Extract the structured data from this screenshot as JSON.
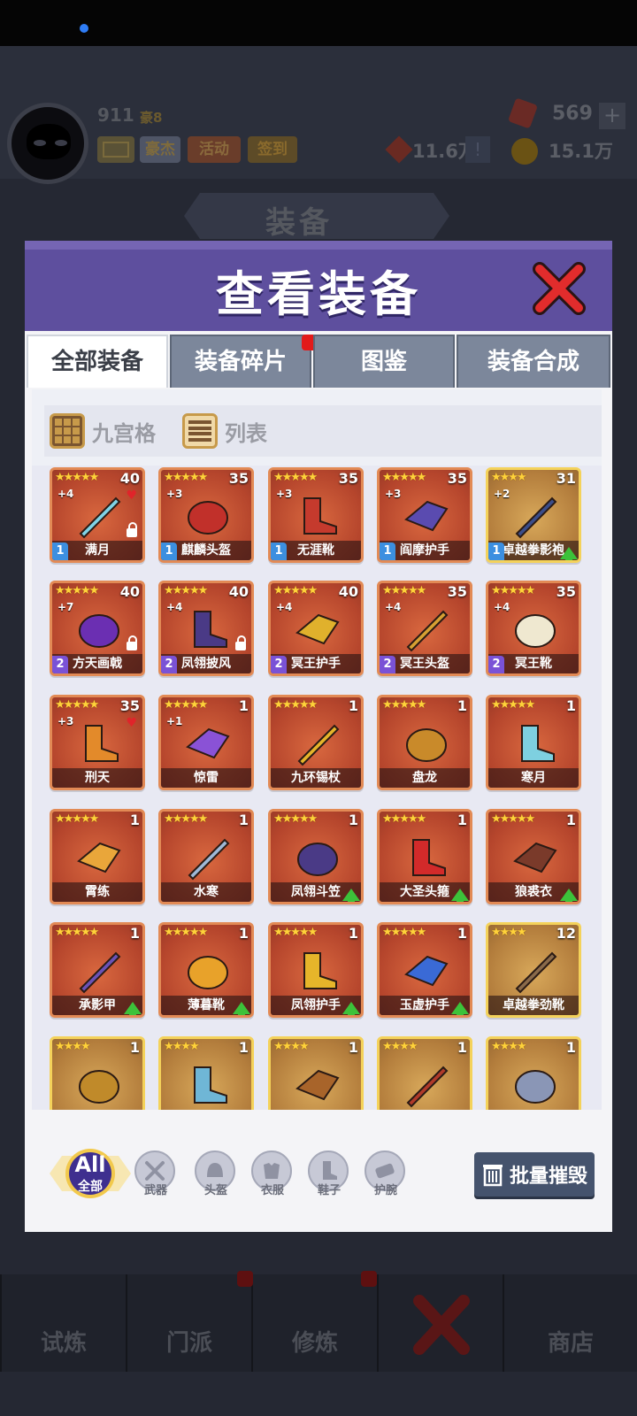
{
  "header": {
    "level": "911",
    "rank_label": "豪8",
    "buttons": {
      "mail": "",
      "hero": "豪杰",
      "activity": "活动",
      "sign": "签到"
    },
    "gem_value": "569",
    "plus": "+",
    "power_value": "11.6万",
    "alert": "!",
    "coin_value": "15.1万"
  },
  "bg_banner_title": "装备",
  "bottom_nav": [
    "试炼",
    "门派",
    "修炼",
    "",
    "商店"
  ],
  "dialog": {
    "title": "查看装备",
    "tabs": [
      "全部装备",
      "装备碎片",
      "图鉴",
      "装备合成"
    ],
    "active_tab": 0,
    "view_options": [
      "九宫格",
      "列表"
    ],
    "filters": [
      {
        "label": "全部",
        "icon": "all-icon"
      },
      {
        "label": "武器",
        "icon": "sword-icon"
      },
      {
        "label": "头盔",
        "icon": "helmet-icon"
      },
      {
        "label": "衣服",
        "icon": "armor-icon"
      },
      {
        "label": "鞋子",
        "icon": "boot-icon"
      },
      {
        "label": "护腕",
        "icon": "bracer-icon"
      }
    ],
    "filter_all_text": "All",
    "batch_button": "批量摧毁"
  },
  "items": [
    {
      "name": "满月",
      "stars": "★★★★★",
      "count": "40",
      "enh": "+4",
      "tier": "1",
      "lock": true,
      "heart": true,
      "up": false,
      "rarity": "red",
      "art": "#7fd3e6"
    },
    {
      "name": "麒麟头盔",
      "stars": "★★★★★",
      "count": "35",
      "enh": "+3",
      "tier": "1",
      "lock": false,
      "heart": false,
      "up": false,
      "rarity": "red",
      "art": "#c1302a"
    },
    {
      "name": "无涯靴",
      "stars": "★★★★★",
      "count": "35",
      "enh": "+3",
      "tier": "1",
      "lock": false,
      "heart": false,
      "up": false,
      "rarity": "red",
      "art": "#c53a2d"
    },
    {
      "name": "阎摩护手",
      "stars": "★★★★★",
      "count": "35",
      "enh": "+3",
      "tier": "1",
      "lock": false,
      "heart": false,
      "up": false,
      "rarity": "red",
      "art": "#5a4bb0"
    },
    {
      "name": "卓越拳影袍",
      "stars": "★★★★",
      "count": "31",
      "enh": "+2",
      "tier": "1",
      "lock": false,
      "heart": false,
      "up": true,
      "rarity": "gold",
      "art": "#3b4d8a"
    },
    {
      "name": "方天画戟",
      "stars": "★★★★★",
      "count": "40",
      "enh": "+7",
      "tier": "2",
      "lock": true,
      "heart": false,
      "up": false,
      "rarity": "red",
      "art": "#6b2fb2"
    },
    {
      "name": "凤翎披风",
      "stars": "★★★★★",
      "count": "40",
      "enh": "+4",
      "tier": "2",
      "lock": true,
      "heart": false,
      "up": false,
      "rarity": "red",
      "art": "#4a3a86"
    },
    {
      "name": "冥王护手",
      "stars": "★★★★★",
      "count": "40",
      "enh": "+4",
      "tier": "2",
      "lock": false,
      "heart": false,
      "up": false,
      "rarity": "red",
      "art": "#e0b12c"
    },
    {
      "name": "冥王头盔",
      "stars": "★★★★★",
      "count": "35",
      "enh": "+4",
      "tier": "2",
      "lock": false,
      "heart": false,
      "up": false,
      "rarity": "red",
      "art": "#d6a032"
    },
    {
      "name": "冥王靴",
      "stars": "★★★★★",
      "count": "35",
      "enh": "+4",
      "tier": "2",
      "lock": false,
      "heart": false,
      "up": false,
      "rarity": "red",
      "art": "#efe8d0"
    },
    {
      "name": "刑天",
      "stars": "★★★★★",
      "count": "35",
      "enh": "+3",
      "tier": "",
      "lock": false,
      "heart": true,
      "up": false,
      "rarity": "red",
      "art": "#e38a2a"
    },
    {
      "name": "惊雷",
      "stars": "★★★★★",
      "count": "1",
      "enh": "+1",
      "tier": "",
      "lock": false,
      "heart": false,
      "up": false,
      "rarity": "red",
      "art": "#8a52d6"
    },
    {
      "name": "九环锡杖",
      "stars": "★★★★★",
      "count": "1",
      "enh": "",
      "tier": "",
      "lock": false,
      "heart": false,
      "up": false,
      "rarity": "red",
      "art": "#e6b52a"
    },
    {
      "name": "盘龙",
      "stars": "★★★★★",
      "count": "1",
      "enh": "",
      "tier": "",
      "lock": false,
      "heart": false,
      "up": false,
      "rarity": "red",
      "art": "#c98a2a"
    },
    {
      "name": "寒月",
      "stars": "★★★★★",
      "count": "1",
      "enh": "",
      "tier": "",
      "lock": false,
      "heart": false,
      "up": false,
      "rarity": "red",
      "art": "#7ed0e0"
    },
    {
      "name": "霄练",
      "stars": "★★★★★",
      "count": "1",
      "enh": "",
      "tier": "",
      "lock": false,
      "heart": false,
      "up": false,
      "rarity": "red",
      "art": "#e9a63a"
    },
    {
      "name": "水寒",
      "stars": "★★★★★",
      "count": "1",
      "enh": "",
      "tier": "",
      "lock": false,
      "heart": false,
      "up": false,
      "rarity": "red",
      "art": "#9fb8d6"
    },
    {
      "name": "凤翎斗笠",
      "stars": "★★★★★",
      "count": "1",
      "enh": "",
      "tier": "",
      "lock": false,
      "heart": false,
      "up": true,
      "rarity": "red",
      "art": "#4a3a86"
    },
    {
      "name": "大圣头箍",
      "stars": "★★★★★",
      "count": "1",
      "enh": "",
      "tier": "",
      "lock": false,
      "heart": false,
      "up": true,
      "rarity": "red",
      "art": "#d22a2a"
    },
    {
      "name": "狼裘衣",
      "stars": "★★★★★",
      "count": "1",
      "enh": "",
      "tier": "",
      "lock": false,
      "heart": false,
      "up": true,
      "rarity": "red",
      "art": "#7a3a2a"
    },
    {
      "name": "承影甲",
      "stars": "★★★★★",
      "count": "1",
      "enh": "",
      "tier": "",
      "lock": false,
      "heart": false,
      "up": true,
      "rarity": "red",
      "art": "#6a52b6"
    },
    {
      "name": "薄暮靴",
      "stars": "★★★★★",
      "count": "1",
      "enh": "",
      "tier": "",
      "lock": false,
      "heart": false,
      "up": true,
      "rarity": "red",
      "art": "#e8a22a"
    },
    {
      "name": "凤翎护手",
      "stars": "★★★★★",
      "count": "1",
      "enh": "",
      "tier": "",
      "lock": false,
      "heart": false,
      "up": true,
      "rarity": "red",
      "art": "#e6b52a"
    },
    {
      "name": "玉虚护手",
      "stars": "★★★★★",
      "count": "1",
      "enh": "",
      "tier": "",
      "lock": false,
      "heart": false,
      "up": true,
      "rarity": "red",
      "art": "#3a6ad6"
    },
    {
      "name": "卓越拳劲靴",
      "stars": "★★★★",
      "count": "12",
      "enh": "",
      "tier": "",
      "lock": false,
      "heart": false,
      "up": false,
      "rarity": "gold",
      "art": "#8a6a4a"
    },
    {
      "name": "",
      "stars": "★★★★",
      "count": "1",
      "enh": "",
      "tier": "",
      "lock": false,
      "heart": false,
      "up": false,
      "rarity": "gold",
      "art": "#c08a2a"
    },
    {
      "name": "",
      "stars": "★★★★",
      "count": "1",
      "enh": "",
      "tier": "",
      "lock": false,
      "heart": false,
      "up": false,
      "rarity": "gold",
      "art": "#6fb6d6"
    },
    {
      "name": "",
      "stars": "★★★★",
      "count": "1",
      "enh": "",
      "tier": "",
      "lock": false,
      "heart": false,
      "up": false,
      "rarity": "gold",
      "art": "#a8642a"
    },
    {
      "name": "",
      "stars": "★★★★",
      "count": "1",
      "enh": "",
      "tier": "",
      "lock": false,
      "heart": false,
      "up": false,
      "rarity": "gold",
      "art": "#b03a2a"
    },
    {
      "name": "",
      "stars": "★★★★",
      "count": "1",
      "enh": "",
      "tier": "",
      "lock": false,
      "heart": false,
      "up": false,
      "rarity": "gold",
      "art": "#8a96b6"
    }
  ]
}
